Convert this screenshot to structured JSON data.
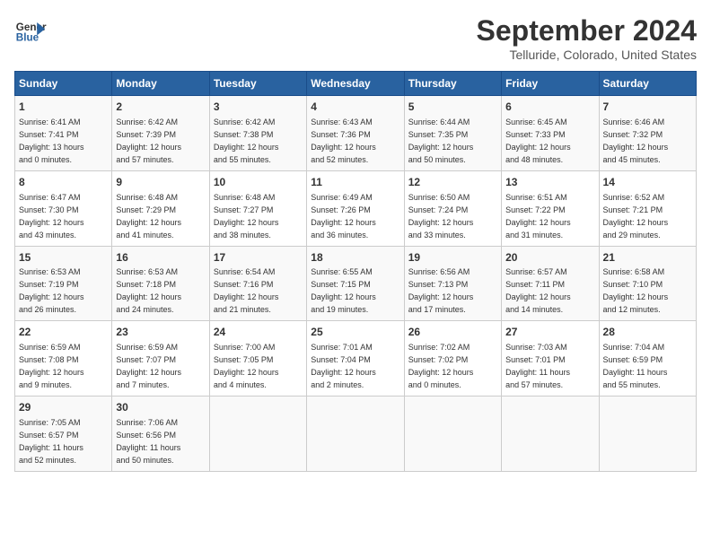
{
  "header": {
    "logo_line1": "General",
    "logo_line2": "Blue",
    "title": "September 2024",
    "subtitle": "Telluride, Colorado, United States"
  },
  "days_of_week": [
    "Sunday",
    "Monday",
    "Tuesday",
    "Wednesday",
    "Thursday",
    "Friday",
    "Saturday"
  ],
  "weeks": [
    [
      {
        "day": "1",
        "info": "Sunrise: 6:41 AM\nSunset: 7:41 PM\nDaylight: 13 hours\nand 0 minutes."
      },
      {
        "day": "2",
        "info": "Sunrise: 6:42 AM\nSunset: 7:39 PM\nDaylight: 12 hours\nand 57 minutes."
      },
      {
        "day": "3",
        "info": "Sunrise: 6:42 AM\nSunset: 7:38 PM\nDaylight: 12 hours\nand 55 minutes."
      },
      {
        "day": "4",
        "info": "Sunrise: 6:43 AM\nSunset: 7:36 PM\nDaylight: 12 hours\nand 52 minutes."
      },
      {
        "day": "5",
        "info": "Sunrise: 6:44 AM\nSunset: 7:35 PM\nDaylight: 12 hours\nand 50 minutes."
      },
      {
        "day": "6",
        "info": "Sunrise: 6:45 AM\nSunset: 7:33 PM\nDaylight: 12 hours\nand 48 minutes."
      },
      {
        "day": "7",
        "info": "Sunrise: 6:46 AM\nSunset: 7:32 PM\nDaylight: 12 hours\nand 45 minutes."
      }
    ],
    [
      {
        "day": "8",
        "info": "Sunrise: 6:47 AM\nSunset: 7:30 PM\nDaylight: 12 hours\nand 43 minutes."
      },
      {
        "day": "9",
        "info": "Sunrise: 6:48 AM\nSunset: 7:29 PM\nDaylight: 12 hours\nand 41 minutes."
      },
      {
        "day": "10",
        "info": "Sunrise: 6:48 AM\nSunset: 7:27 PM\nDaylight: 12 hours\nand 38 minutes."
      },
      {
        "day": "11",
        "info": "Sunrise: 6:49 AM\nSunset: 7:26 PM\nDaylight: 12 hours\nand 36 minutes."
      },
      {
        "day": "12",
        "info": "Sunrise: 6:50 AM\nSunset: 7:24 PM\nDaylight: 12 hours\nand 33 minutes."
      },
      {
        "day": "13",
        "info": "Sunrise: 6:51 AM\nSunset: 7:22 PM\nDaylight: 12 hours\nand 31 minutes."
      },
      {
        "day": "14",
        "info": "Sunrise: 6:52 AM\nSunset: 7:21 PM\nDaylight: 12 hours\nand 29 minutes."
      }
    ],
    [
      {
        "day": "15",
        "info": "Sunrise: 6:53 AM\nSunset: 7:19 PM\nDaylight: 12 hours\nand 26 minutes."
      },
      {
        "day": "16",
        "info": "Sunrise: 6:53 AM\nSunset: 7:18 PM\nDaylight: 12 hours\nand 24 minutes."
      },
      {
        "day": "17",
        "info": "Sunrise: 6:54 AM\nSunset: 7:16 PM\nDaylight: 12 hours\nand 21 minutes."
      },
      {
        "day": "18",
        "info": "Sunrise: 6:55 AM\nSunset: 7:15 PM\nDaylight: 12 hours\nand 19 minutes."
      },
      {
        "day": "19",
        "info": "Sunrise: 6:56 AM\nSunset: 7:13 PM\nDaylight: 12 hours\nand 17 minutes."
      },
      {
        "day": "20",
        "info": "Sunrise: 6:57 AM\nSunset: 7:11 PM\nDaylight: 12 hours\nand 14 minutes."
      },
      {
        "day": "21",
        "info": "Sunrise: 6:58 AM\nSunset: 7:10 PM\nDaylight: 12 hours\nand 12 minutes."
      }
    ],
    [
      {
        "day": "22",
        "info": "Sunrise: 6:59 AM\nSunset: 7:08 PM\nDaylight: 12 hours\nand 9 minutes."
      },
      {
        "day": "23",
        "info": "Sunrise: 6:59 AM\nSunset: 7:07 PM\nDaylight: 12 hours\nand 7 minutes."
      },
      {
        "day": "24",
        "info": "Sunrise: 7:00 AM\nSunset: 7:05 PM\nDaylight: 12 hours\nand 4 minutes."
      },
      {
        "day": "25",
        "info": "Sunrise: 7:01 AM\nSunset: 7:04 PM\nDaylight: 12 hours\nand 2 minutes."
      },
      {
        "day": "26",
        "info": "Sunrise: 7:02 AM\nSunset: 7:02 PM\nDaylight: 12 hours\nand 0 minutes."
      },
      {
        "day": "27",
        "info": "Sunrise: 7:03 AM\nSunset: 7:01 PM\nDaylight: 11 hours\nand 57 minutes."
      },
      {
        "day": "28",
        "info": "Sunrise: 7:04 AM\nSunset: 6:59 PM\nDaylight: 11 hours\nand 55 minutes."
      }
    ],
    [
      {
        "day": "29",
        "info": "Sunrise: 7:05 AM\nSunset: 6:57 PM\nDaylight: 11 hours\nand 52 minutes."
      },
      {
        "day": "30",
        "info": "Sunrise: 7:06 AM\nSunset: 6:56 PM\nDaylight: 11 hours\nand 50 minutes."
      },
      {
        "day": "",
        "info": ""
      },
      {
        "day": "",
        "info": ""
      },
      {
        "day": "",
        "info": ""
      },
      {
        "day": "",
        "info": ""
      },
      {
        "day": "",
        "info": ""
      }
    ]
  ]
}
